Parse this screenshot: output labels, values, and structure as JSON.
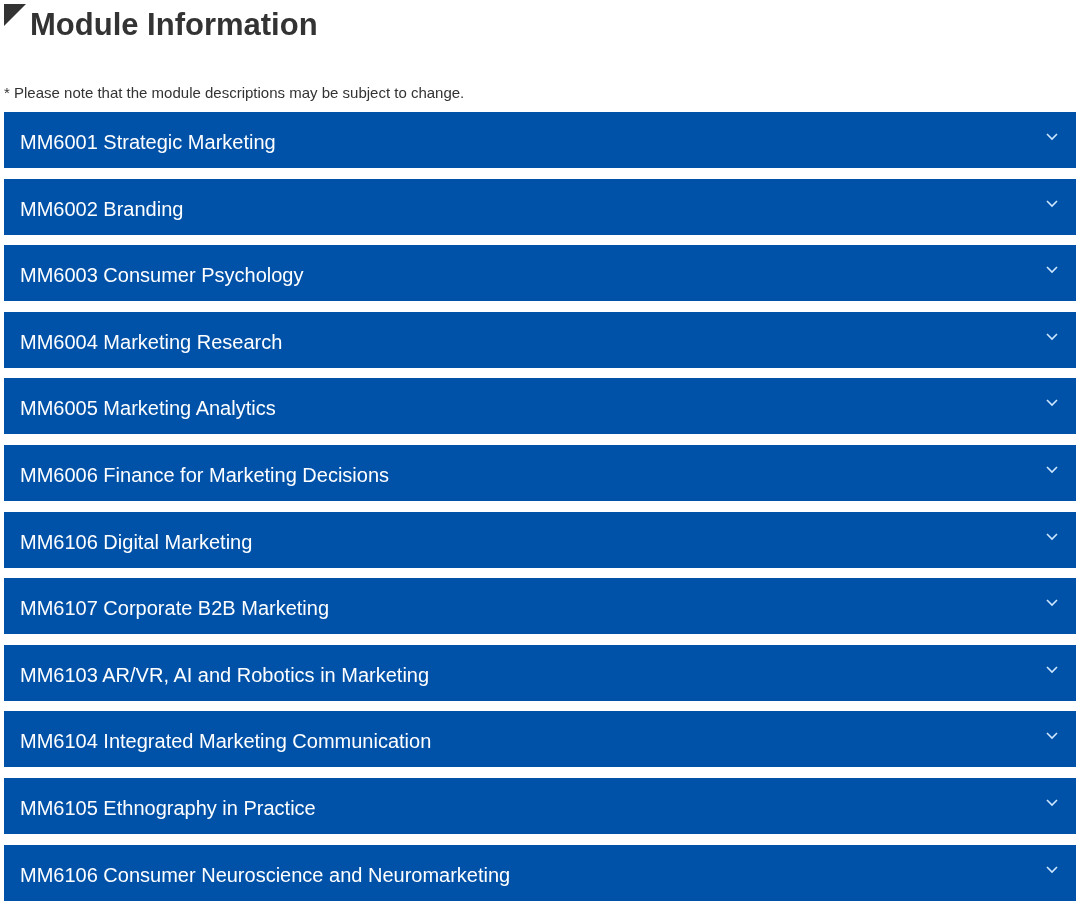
{
  "heading": "Module Information",
  "note": "* Please note that the module descriptions may be subject to change.",
  "modules": [
    {
      "title": "MM6001 Strategic Marketing",
      "expanded": false
    },
    {
      "title": "MM6002 Branding",
      "expanded": false
    },
    {
      "title": "MM6003 Consumer Psychology",
      "expanded": false
    },
    {
      "title": "MM6004 Marketing Research",
      "expanded": false
    },
    {
      "title": "MM6005 Marketing Analytics",
      "expanded": false
    },
    {
      "title": "MM6006 Finance for Marketing Decisions",
      "expanded": false
    },
    {
      "title": "MM6106 Digital Marketing",
      "expanded": false
    },
    {
      "title": "MM6107 Corporate B2B Marketing",
      "expanded": false
    },
    {
      "title": "MM6103 AR/VR, AI and Robotics in Marketing",
      "expanded": false
    },
    {
      "title": "MM6104 Integrated Marketing Communication",
      "expanded": false
    },
    {
      "title": "MM6105 Ethnography in Practice",
      "expanded": false
    },
    {
      "title": "MM6106 Consumer Neuroscience and Neuromarketing",
      "expanded": false
    }
  ]
}
